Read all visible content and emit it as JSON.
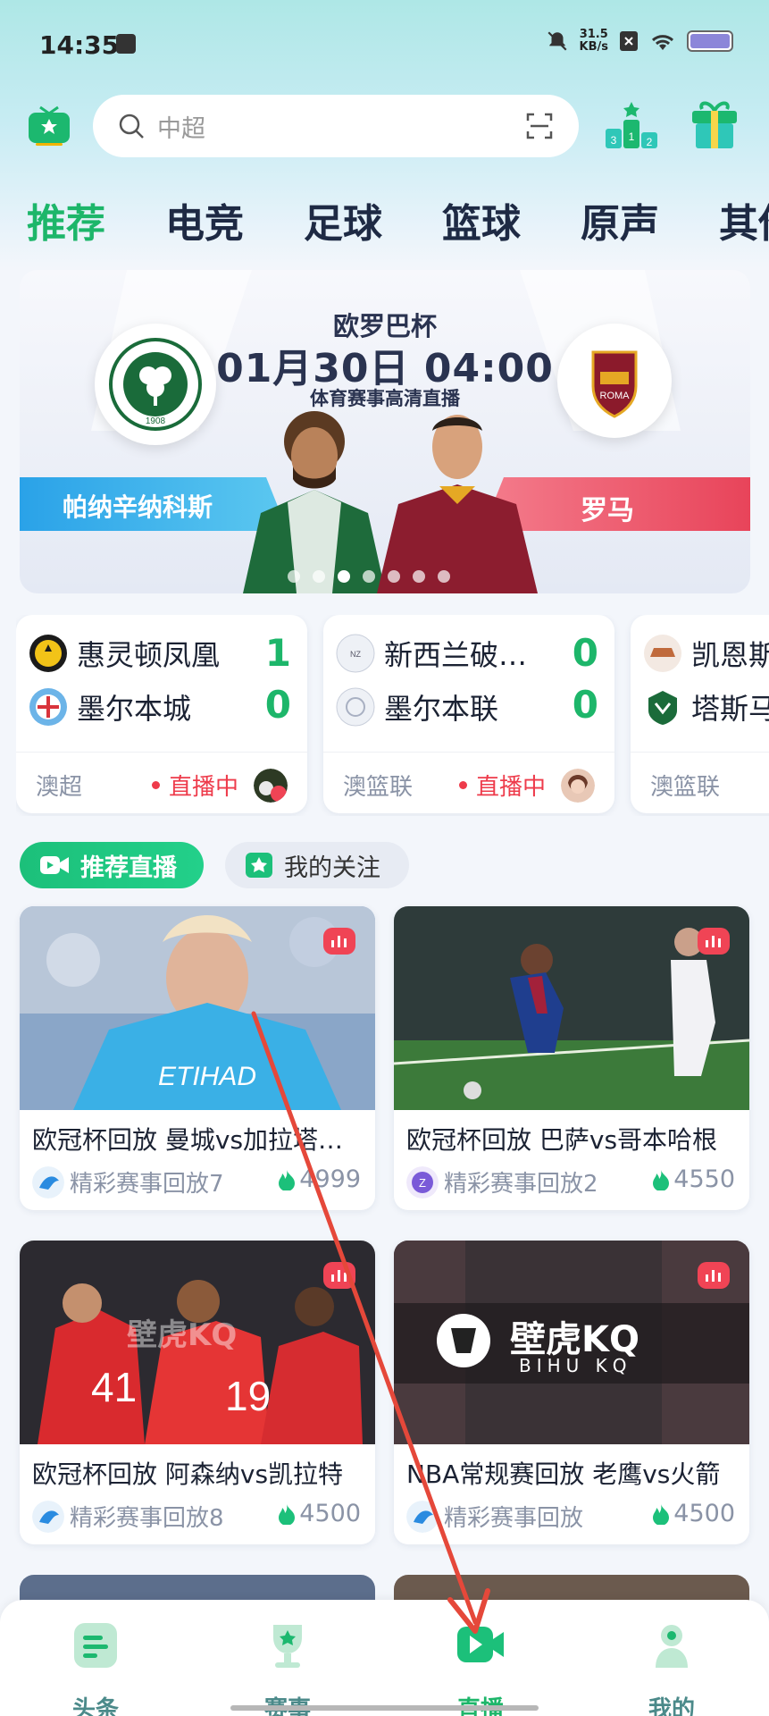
{
  "status": {
    "time": "14:35",
    "speed_value": "31.5",
    "speed_unit": "KB/s"
  },
  "search": {
    "placeholder": "中超"
  },
  "tabs": [
    "推荐",
    "电竞",
    "足球",
    "篮球",
    "原声",
    "其他"
  ],
  "banner": {
    "league": "欧罗巴杯",
    "datetime": "01月30日 04:00",
    "subtitle": "体育赛事高清直播",
    "home_team": "帕纳辛纳科斯",
    "away_team": "罗马",
    "home_crest_text": "1908",
    "away_crest_text": "ROMA"
  },
  "matches": [
    {
      "home": "惠灵顿凤凰",
      "home_score": "1",
      "away": "墨尔本城",
      "away_score": "0",
      "league": "澳超",
      "status": "直播中"
    },
    {
      "home": "新西兰破…",
      "home_score": "0",
      "away": "墨尔本联",
      "away_score": "0",
      "league": "澳篮联",
      "status": "直播中"
    },
    {
      "home": "凯恩斯",
      "home_score": "",
      "away": "塔斯马",
      "away_score": "",
      "league": "澳篮联",
      "status": ""
    }
  ],
  "sub_tabs": {
    "recommended": "推荐直播",
    "following": "我的关注"
  },
  "videos": [
    {
      "title": "欧冠杯回放 曼城vs加拉塔…",
      "channel": "精彩赛事回放7",
      "heat": "4999"
    },
    {
      "title": "欧冠杯回放  巴萨vs哥本哈根",
      "channel": "精彩赛事回放2",
      "heat": "4550"
    },
    {
      "title": "欧冠杯回放   阿森纳vs凯拉特",
      "channel": "精彩赛事回放8",
      "heat": "4500"
    },
    {
      "title": "NBA常规赛回放  老鹰vs火箭",
      "channel": "精彩赛事回放",
      "heat": "4500"
    }
  ],
  "watermark": {
    "brand": "壁虎KQ",
    "brand_sub": "BIHU KQ"
  },
  "nav": [
    "头条",
    "赛事",
    "直播",
    "我的"
  ],
  "colors": {
    "accent": "#1db66a",
    "live_red": "#ee3b4b",
    "annotation_arrow": "#e5483a"
  },
  "icons": [
    "tv-logo-icon",
    "search-icon",
    "scan-icon",
    "ranking-icon",
    "gift-icon",
    "video-camera-icon",
    "star-icon",
    "fire-icon",
    "live-signal-icon",
    "news-icon",
    "trophy-icon",
    "play-icon",
    "profile-icon"
  ]
}
